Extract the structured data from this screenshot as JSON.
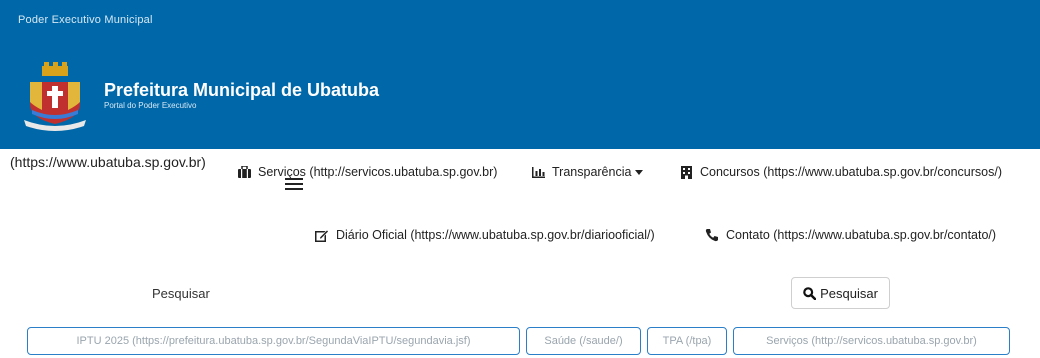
{
  "header": {
    "top_label": "Poder Executivo Municipal",
    "title": "Prefeitura Municipal de Ubatuba",
    "subtitle": "Portal do Poder Executivo",
    "background": "#0068a8"
  },
  "home_link": "(https://www.ubatuba.sp.gov.br)",
  "nav": {
    "servicos": "Serviços (http://servicos.ubatuba.sp.gov.br)",
    "transparencia": "Transparência",
    "concursos": "Concursos (https://www.ubatuba.sp.gov.br/concursos/)",
    "diario": "Diário Oficial (https://www.ubatuba.sp.gov.br/diariooficial/)",
    "contato": "Contato (https://www.ubatuba.sp.gov.br/contato/)",
    "icons": [
      "briefcase-icon",
      "bar-chart-icon",
      "caret-down-icon",
      "building-icon",
      "edit-icon",
      "phone-icon",
      "menu-icon"
    ]
  },
  "search": {
    "label": "Pesquisar",
    "button_label": "Pesquisar"
  },
  "quick_links": [
    "IPTU 2025 (https://prefeitura.ubatuba.sp.gov.br/SegundaViaIPTU/segundavia.jsf)",
    "Saúde (/saude/)",
    "TPA (/tpa)",
    "Serviços (http://servicos.ubatuba.sp.gov.br)"
  ],
  "colors": {
    "accent": "#2b7fc9"
  }
}
